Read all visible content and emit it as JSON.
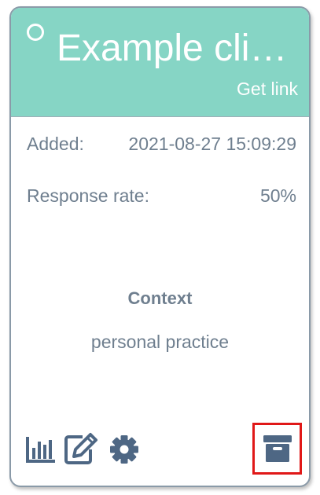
{
  "card": {
    "title": "Example clie…",
    "get_link_label": "Get link",
    "added_label": "Added:",
    "added_value": "2021-08-27 15:09:29",
    "response_rate_label": "Response rate:",
    "response_rate_value": "50%",
    "context_heading": "Context",
    "context_value": "personal practice"
  },
  "colors": {
    "header": "#86d5c5",
    "text": "#6f7f8f",
    "icon": "#4e6784",
    "highlight_border": "#e01818"
  },
  "icons": {
    "status": "circle-outline-icon",
    "stats": "bar-chart-icon",
    "edit": "edit-icon",
    "settings": "gear-icon",
    "archive": "archive-icon"
  }
}
